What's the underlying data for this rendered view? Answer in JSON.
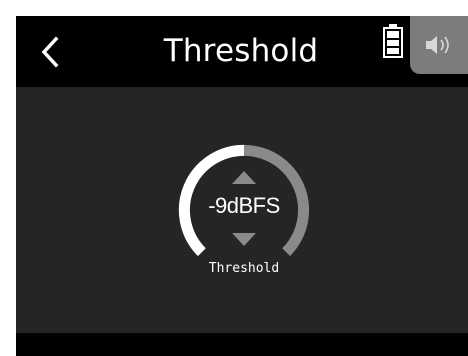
{
  "header": {
    "title": "Threshold",
    "back_icon": "chevron-left-icon",
    "battery_icon": "battery-full-icon",
    "speaker_icon": "speaker-icon"
  },
  "knob": {
    "value": "-9dBFS",
    "label": "Threshold",
    "up_icon": "triangle-up-icon",
    "down_icon": "triangle-down-icon"
  },
  "colors": {
    "screen_bg": "#252525",
    "header_bg": "#000000",
    "knob_track": "#8a8a8a",
    "knob_fill": "#ffffff",
    "arrow": "#8a8a8a",
    "speaker_tab_bg": "#7c7c7c"
  }
}
